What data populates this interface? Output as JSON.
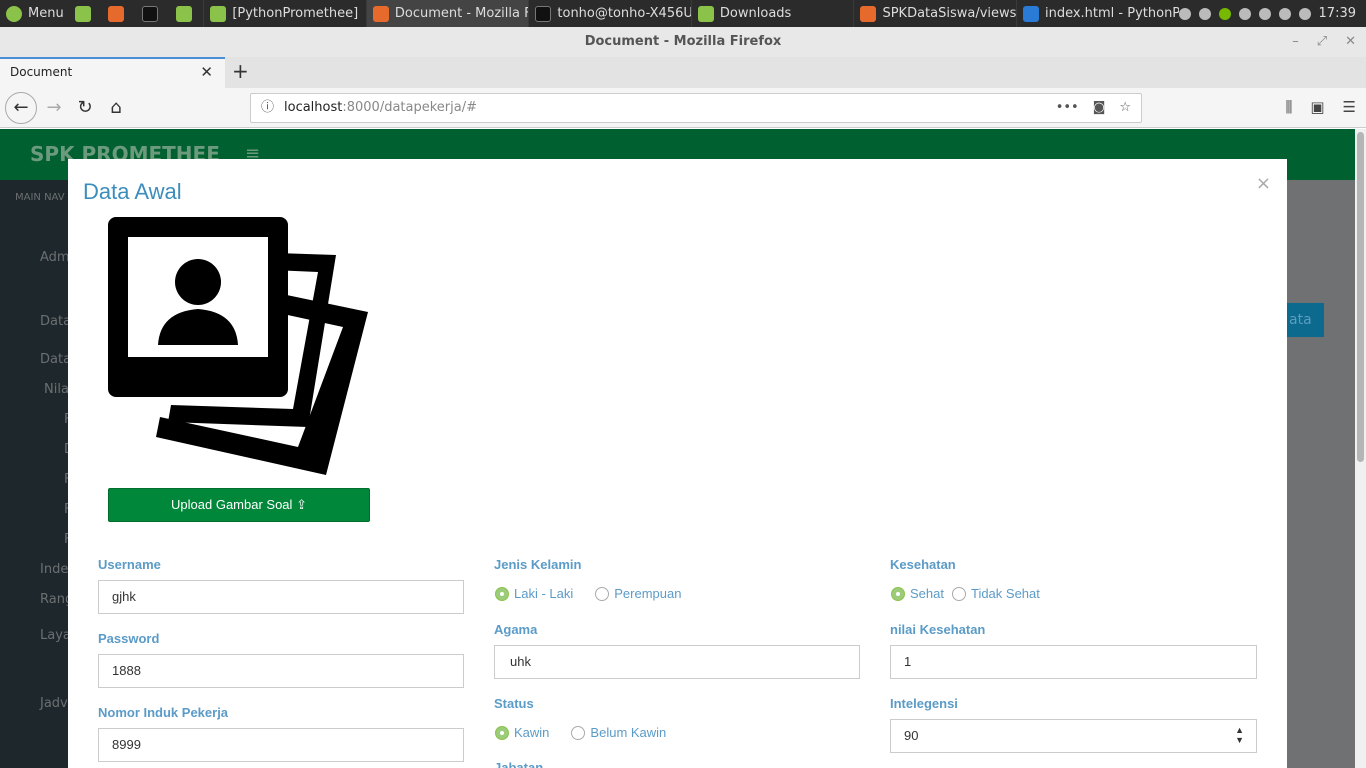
{
  "taskbar": {
    "menu_label": "Menu",
    "windows": [
      "[PythonPromethee]",
      "Document - Mozilla F...",
      "tonho@tonho-X456U...",
      "Downloads",
      "SPKDataSiswa/views....",
      "index.html - PythonPr..."
    ],
    "clock": "17:39"
  },
  "browser": {
    "window_title": "Document - Mozilla Firefox",
    "tab_title": "Document",
    "url_host": "localhost",
    "url_rest": ":8000/datapekerja/#"
  },
  "app": {
    "logo": "SPK PROMETHEE",
    "sidebar_items": [
      "MAIN NAV",
      "Adm",
      "Data",
      "Data",
      "Nila",
      "F",
      "D",
      "F",
      "F",
      "F",
      "Inde",
      "Rang",
      "Laya",
      "Jadv"
    ],
    "overlay_button_fragment": "ata"
  },
  "modal": {
    "title": "Data Awal",
    "close": "×",
    "upload_button": "Upload Gambar Soal",
    "fields": {
      "username_label": "Username",
      "username_value": "gjhk",
      "password_label": "Password",
      "password_value": "1888",
      "nip_label": "Nomor Induk Pekerja",
      "nip_value": "8999",
      "gender_label": "Jenis Kelamin",
      "gender_opt1": "Laki - Laki",
      "gender_opt2": "Perempuan",
      "agama_label": "Agama",
      "agama_value": "uhk",
      "status_label": "Status",
      "status_opt1": "Kawin",
      "status_opt2": "Belum Kawin",
      "jabatan_label": "Jabatan",
      "kesehatan_label": "Kesehatan",
      "kesehatan_opt1": "Sehat",
      "kesehatan_opt2": "Tidak Sehat",
      "nilai_kesehatan_label": "nilai Kesehatan",
      "nilai_kesehatan_value": "1",
      "intelegensi_label": "Intelegensi",
      "intelegensi_value": "90"
    }
  }
}
